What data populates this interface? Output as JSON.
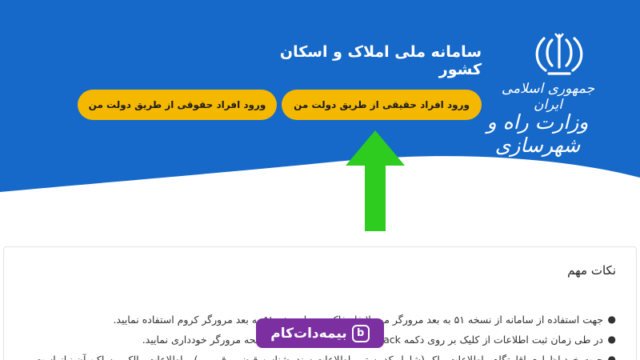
{
  "colors": {
    "header_blue": "#1669c9",
    "button_yellow": "#f5b800",
    "arrow_green": "#2ecc1f",
    "watermark_purple": "#7b2fa0"
  },
  "header": {
    "site_title": "سامانه ملی املاک و اسکان کشور",
    "emblem_icon": "iran-emblem-icon",
    "gov_line1": "جمهوری اسلامی ایران",
    "gov_line2": "وزارت راه و شهرسازی"
  },
  "login": {
    "real_persons_label": "ورود افراد حقیقی از طریق دولت من",
    "legal_persons_label": "ورود افراد حقوقی از طریق دولت من"
  },
  "notes": {
    "title": "نکات مهم",
    "items": [
      "جهت استفاده از سامانه از نسخه ۵۱ به بعد مرورگر موزیلا فایرفاکس و یا نسخه ۵۱ به بعد مرورگر کروم استفاده نمایید.",
      "در طی زمان ثبت اطلاعات از کلیک بر روی دکمه Back مرورگر و یا انتقال از یک صفحه مرورگر خودداری نمایید.",
      "جهت خود اظهاری اقامتگاه ، اطلاعات ملک (شامل کد پستی، اطلاعات سند، شناسه قبض برق و ...) و اطلاعات مالک و ساکن آن نیاز است."
    ]
  },
  "watermark": {
    "icon": "b-logo-icon",
    "text": "بیمه‌دات‌کام"
  }
}
